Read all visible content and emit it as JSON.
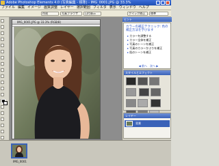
{
  "app": {
    "title": "Adobe Photoshop Elements 4.0 (写真編集 - 標準) - IMG_0001.JPG @ 33.3%"
  },
  "menu": [
    "ファイル",
    "編集",
    "イメージ",
    "画質調整",
    "レイヤー",
    "選択範囲",
    "フィルタ",
    "表示",
    "ウィンドウ",
    "ヘルプ"
  ],
  "options_bar": {
    "buttons": [
      "作成",
      "写真ブラウザ",
      "日付表示",
      "クイック修正",
      "標準"
    ]
  },
  "document": {
    "title": "IMG_0001.JPG @ 33.3% (RGB/8)"
  },
  "panels": {
    "tips_header": "ヒント",
    "tips_title": "カラーの補正テクニック: 色の補正方法を学びます",
    "tips_items": [
      "カラーを調整する",
      "カラー全体を補正",
      "写真のトーンを補正",
      "写真のカラーかぶりを補正",
      "肌のトーンを補正"
    ],
    "tips_nav": "◀ 前へ　次へ ▶",
    "styles_header": "スタイルとエフェクト",
    "layers_header": "レイヤー",
    "layer_name": "背景"
  },
  "photo_bin": {
    "label": "IMG_0001"
  },
  "status": "33.33%"
}
